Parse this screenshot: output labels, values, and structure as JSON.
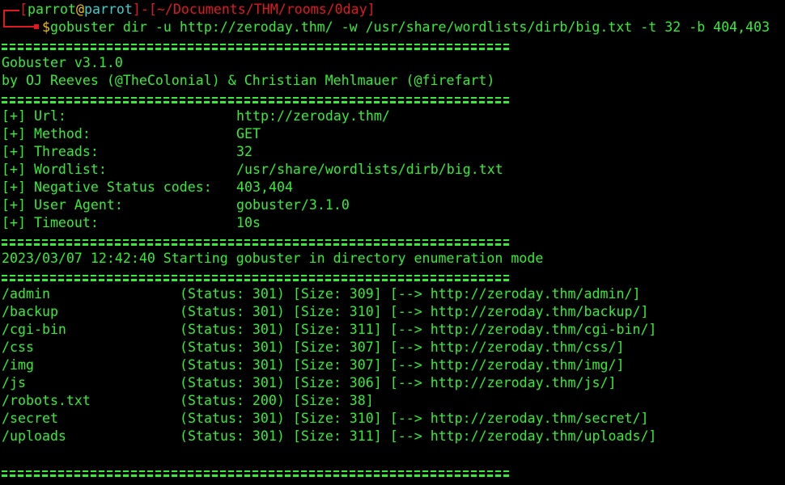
{
  "prompt": {
    "open_bracket": "[",
    "user": "parrot",
    "at": "@",
    "host": "parrot",
    "close_bracket": "]",
    "dash": "-",
    "cwd": "[~/Documents/THM/rooms/0day]",
    "dollar": "$",
    "command": "gobuster dir -u http://zeroday.thm/ -w /usr/share/wordlists/dirb/big.txt -t 32 -b 404,403"
  },
  "banner": {
    "version": "Gobuster v3.1.0",
    "authors": "by OJ Reeves (@TheColonial) & Christian Mehlmauer (@firefart)"
  },
  "config": [
    {
      "key": "[+] Url:",
      "value": "http://zeroday.thm/"
    },
    {
      "key": "[+] Method:",
      "value": "GET"
    },
    {
      "key": "[+] Threads:",
      "value": "32"
    },
    {
      "key": "[+] Wordlist:",
      "value": "/usr/share/wordlists/dirb/big.txt"
    },
    {
      "key": "[+] Negative Status codes:",
      "value": "403,404"
    },
    {
      "key": "[+] User Agent:",
      "value": "gobuster/3.1.0"
    },
    {
      "key": "[+] Timeout:",
      "value": "10s"
    }
  ],
  "start_message": "2023/03/07 12:42:40 Starting gobuster in directory enumeration mode",
  "results": [
    {
      "path": "/admin",
      "info": "(Status: 301) [Size: 309] [--> http://zeroday.thm/admin/]"
    },
    {
      "path": "/backup",
      "info": "(Status: 301) [Size: 310] [--> http://zeroday.thm/backup/]"
    },
    {
      "path": "/cgi-bin",
      "info": "(Status: 301) [Size: 311] [--> http://zeroday.thm/cgi-bin/]"
    },
    {
      "path": "/css",
      "info": "(Status: 301) [Size: 307] [--> http://zeroday.thm/css/]"
    },
    {
      "path": "/img",
      "info": "(Status: 301) [Size: 307] [--> http://zeroday.thm/img/]"
    },
    {
      "path": "/js",
      "info": "(Status: 301) [Size: 306] [--> http://zeroday.thm/js/]"
    },
    {
      "path": "/robots.txt",
      "info": "(Status: 200) [Size: 38]"
    },
    {
      "path": "/secret",
      "info": "(Status: 301) [Size: 310] [--> http://zeroday.thm/secret/]"
    },
    {
      "path": "/uploads",
      "info": "(Status: 301) [Size: 311] [--> http://zeroday.thm/uploads/]"
    }
  ],
  "colors": {
    "background": "#000000",
    "text": "#33ee33",
    "prompt_red": "#e0191f",
    "at_yellow": "#f2c200",
    "host_cyan": "#35d1d1"
  }
}
